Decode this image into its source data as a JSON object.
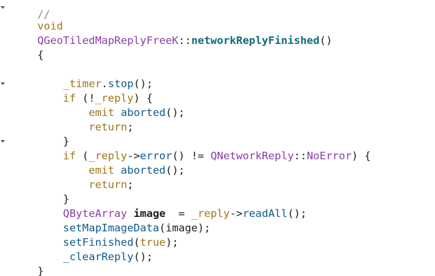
{
  "colors": {
    "background": "#ffffff",
    "plain": "#1f1c1b",
    "keyword": "#a1741a",
    "type": "#8a3da8",
    "function": "#0f5a8a",
    "decl_function": "#0f6b7a",
    "punct": "#1f1c1b"
  },
  "code": {
    "l0": {
      "a": "//"
    },
    "l1": {
      "a": "void"
    },
    "l2": {
      "a": "QGeoTiledMapReplyFreeK",
      "b": "::",
      "c": "networkReplyFinished",
      "d": "()"
    },
    "l3": {
      "a": "{"
    },
    "l5": {
      "a": "_timer",
      "b": ".",
      "c": "stop",
      "d": "();"
    },
    "l6": {
      "a": "if",
      "b": " (!",
      "c": "_reply",
      "d": ") {"
    },
    "l7": {
      "a": "emit",
      "b": " ",
      "c": "aborted",
      "d": "();"
    },
    "l8": {
      "a": "return",
      "b": ";"
    },
    "l9": {
      "a": "}"
    },
    "l10": {
      "a": "if",
      "b": " (",
      "c": "_reply",
      "d": "->",
      "e": "error",
      "f": "() != ",
      "g": "QNetworkReply",
      "h": "::",
      "i": "NoError",
      "j": ") {"
    },
    "l11": {
      "a": "emit",
      "b": " ",
      "c": "aborted",
      "d": "();"
    },
    "l12": {
      "a": "return",
      "b": ";"
    },
    "l13": {
      "a": "}"
    },
    "l14": {
      "a": "QByteArray",
      "b": " ",
      "c": "image",
      "d": "  = ",
      "e": "_reply",
      "f": "->",
      "g": "readAll",
      "h": "();"
    },
    "l15": {
      "a": "setMapImageData",
      "b": "(",
      "c": "image",
      "d": ");"
    },
    "l16": {
      "a": "setFinished",
      "b": "(",
      "c": "true",
      "d": ");"
    },
    "l17": {
      "a": "_clearReply",
      "b": "();"
    },
    "l18": {
      "a": "}"
    }
  },
  "fold_markers": [
    "fold-expanded-icon",
    "fold-expanded-icon",
    "fold-expanded-icon"
  ]
}
